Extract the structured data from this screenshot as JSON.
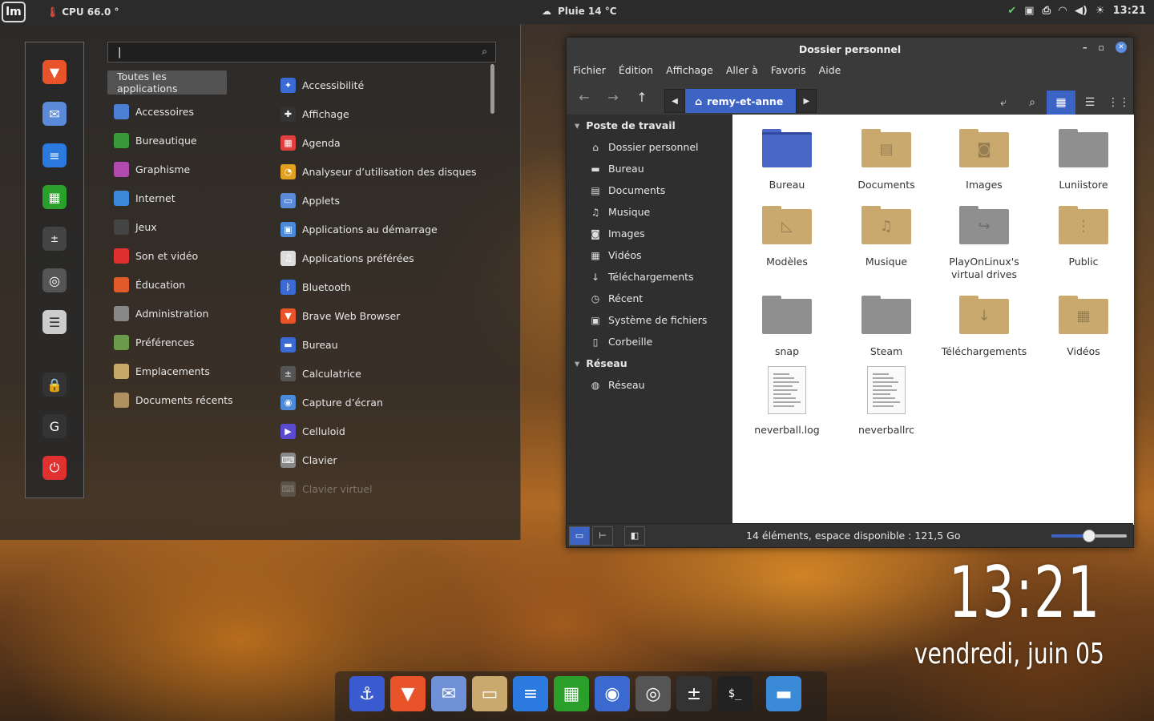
{
  "panel": {
    "cpu": "CPU  66.0 °",
    "weather": "Pluie 14 °C",
    "time": "13:21"
  },
  "menu": {
    "search_value": "|",
    "categories": [
      {
        "label": "Toutes les applications",
        "icon": "all-icon",
        "color": "#5a5a5a"
      },
      {
        "label": "Accessoires",
        "icon": "accessories-icon",
        "color": "#4a7fd4"
      },
      {
        "label": "Bureautique",
        "icon": "office-icon",
        "color": "#3a9a3a"
      },
      {
        "label": "Graphisme",
        "icon": "graphics-icon",
        "color": "#b04ab0"
      },
      {
        "label": "Internet",
        "icon": "internet-icon",
        "color": "#3a8ad8"
      },
      {
        "label": "Jeux",
        "icon": "games-icon",
        "color": "#444"
      },
      {
        "label": "Son et vidéo",
        "icon": "multimedia-icon",
        "color": "#e03030"
      },
      {
        "label": "Éducation",
        "icon": "education-icon",
        "color": "#e05a2a"
      },
      {
        "label": "Administration",
        "icon": "admin-icon",
        "color": "#888"
      },
      {
        "label": "Préférences",
        "icon": "preferences-icon",
        "color": "#6a9a4a"
      },
      {
        "label": "Emplacements",
        "icon": "places-icon",
        "color": "#c7a76a"
      },
      {
        "label": "Documents récents",
        "icon": "recent-icon",
        "color": "#b09060"
      }
    ],
    "apps": [
      {
        "label": "Accessibilité",
        "icon": "accessibility-icon",
        "color": "#3a6ad4",
        "glyph": "✦"
      },
      {
        "label": "Affichage",
        "icon": "display-icon",
        "color": "#333",
        "glyph": "✚"
      },
      {
        "label": "Agenda",
        "icon": "calendar-icon",
        "color": "#e04040",
        "glyph": "▦"
      },
      {
        "label": "Analyseur d’utilisation des disques",
        "icon": "disk-usage-icon",
        "color": "#e0a020",
        "glyph": "◔"
      },
      {
        "label": "Applets",
        "icon": "applets-icon",
        "color": "#5a8ad8",
        "glyph": "▭"
      },
      {
        "label": "Applications au démarrage",
        "icon": "startup-icon",
        "color": "#4a8ad8",
        "glyph": "▣"
      },
      {
        "label": "Applications préférées",
        "icon": "preferred-apps-icon",
        "color": "#ddd",
        "glyph": "♫"
      },
      {
        "label": "Bluetooth",
        "icon": "bluetooth-icon",
        "color": "#3a6ad4",
        "glyph": "ᛒ"
      },
      {
        "label": "Brave Web Browser",
        "icon": "brave-icon",
        "color": "#e8532a",
        "glyph": "▼"
      },
      {
        "label": "Bureau",
        "icon": "desktop-icon",
        "color": "#3a6ad4",
        "glyph": "▬"
      },
      {
        "label": "Calculatrice",
        "icon": "calculator-icon",
        "color": "#555",
        "glyph": "±"
      },
      {
        "label": "Capture d’écran",
        "icon": "screenshot-icon",
        "color": "#4a8ad8",
        "glyph": "◉"
      },
      {
        "label": "Celluloid",
        "icon": "celluloid-icon",
        "color": "#5a4ad0",
        "glyph": "▶"
      },
      {
        "label": "Clavier",
        "icon": "keyboard-icon",
        "color": "#888",
        "glyph": "⌨"
      },
      {
        "label": "Clavier virtuel",
        "icon": "onscreen-keyboard-icon",
        "color": "#888",
        "glyph": "⌨"
      }
    ]
  },
  "filemanager": {
    "title": "Dossier personnel",
    "menus": [
      "Fichier",
      "Édition",
      "Affichage",
      "Aller à",
      "Favoris",
      "Aide"
    ],
    "breadcrumb": "remy-et-anne",
    "sidebar": [
      {
        "type": "header",
        "label": "Poste de travail"
      },
      {
        "type": "item",
        "label": "Dossier personnel",
        "glyph": "⌂",
        "icon": "home-icon"
      },
      {
        "type": "item",
        "label": "Bureau",
        "glyph": "▬",
        "icon": "desktop-icon"
      },
      {
        "type": "item",
        "label": "Documents",
        "glyph": "▤",
        "icon": "documents-icon"
      },
      {
        "type": "item",
        "label": "Musique",
        "glyph": "♫",
        "icon": "music-icon"
      },
      {
        "type": "item",
        "label": "Images",
        "glyph": "◙",
        "icon": "pictures-icon"
      },
      {
        "type": "item",
        "label": "Vidéos",
        "glyph": "▦",
        "icon": "videos-icon"
      },
      {
        "type": "item",
        "label": "Téléchargements",
        "glyph": "↓",
        "icon": "downloads-icon"
      },
      {
        "type": "item",
        "label": "Récent",
        "glyph": "◷",
        "icon": "recent-icon"
      },
      {
        "type": "item",
        "label": "Système de fichiers",
        "glyph": "▣",
        "icon": "filesystem-icon"
      },
      {
        "type": "item",
        "label": "Corbeille",
        "glyph": "▯",
        "icon": "trash-icon"
      },
      {
        "type": "header",
        "label": "Réseau"
      },
      {
        "type": "item",
        "label": "Réseau",
        "glyph": "◍",
        "icon": "network-icon"
      }
    ],
    "items": [
      {
        "label": "Bureau",
        "kind": "folder",
        "color": "#4a67c7",
        "emblem": ""
      },
      {
        "label": "Documents",
        "kind": "folder",
        "color": "#c9a96e",
        "emblem": "▤"
      },
      {
        "label": "Images",
        "kind": "folder",
        "color": "#c9a96e",
        "emblem": "◙"
      },
      {
        "label": "Luniistore",
        "kind": "folder",
        "color": "#8f8f8f",
        "emblem": ""
      },
      {
        "label": "Modèles",
        "kind": "folder",
        "color": "#c9a96e",
        "emblem": "◺"
      },
      {
        "label": "Musique",
        "kind": "folder",
        "color": "#c9a96e",
        "emblem": "♫"
      },
      {
        "label": "PlayOnLinux's virtual drives",
        "kind": "folder",
        "color": "#8f8f8f",
        "emblem": "↪"
      },
      {
        "label": "Public",
        "kind": "folder",
        "color": "#c9a96e",
        "emblem": "⋮"
      },
      {
        "label": "snap",
        "kind": "folder",
        "color": "#8f8f8f",
        "emblem": ""
      },
      {
        "label": "Steam",
        "kind": "folder",
        "color": "#8f8f8f",
        "emblem": ""
      },
      {
        "label": "Téléchargements",
        "kind": "folder",
        "color": "#c9a96e",
        "emblem": "↓"
      },
      {
        "label": "Vidéos",
        "kind": "folder",
        "color": "#c9a96e",
        "emblem": "▦"
      },
      {
        "label": "neverball.log",
        "kind": "doc"
      },
      {
        "label": "neverballrc",
        "kind": "doc"
      }
    ],
    "status": "14 éléments, espace disponible : 121,5 Go",
    "zoom_fraction": 0.5
  },
  "desktop": {
    "clock": "13:21",
    "date": "vendredi, juin 05"
  },
  "dock": [
    {
      "name": "anchor-icon",
      "glyph": "⚓",
      "color": "#3a5ad0"
    },
    {
      "name": "brave-icon",
      "glyph": "▼",
      "color": "#e8532a"
    },
    {
      "name": "mail-icon",
      "glyph": "✉",
      "color": "#7090d8"
    },
    {
      "name": "files-icon",
      "glyph": "▭",
      "color": "#c9a96e"
    },
    {
      "name": "writer-icon",
      "glyph": "≡",
      "color": "#2a7ae0"
    },
    {
      "name": "calc-icon",
      "glyph": "▦",
      "color": "#2aa02a"
    },
    {
      "name": "camera-icon",
      "glyph": "◉",
      "color": "#3a6ad0"
    },
    {
      "name": "playonlinux-icon",
      "glyph": "◎",
      "color": "#555"
    },
    {
      "name": "calculator-icon",
      "glyph": "±",
      "color": "#333"
    },
    {
      "name": "terminal-icon",
      "glyph": "$_",
      "color": "#222"
    },
    {
      "name": "desktop-show-icon",
      "glyph": "▬",
      "color": "#3a8ad8"
    }
  ]
}
